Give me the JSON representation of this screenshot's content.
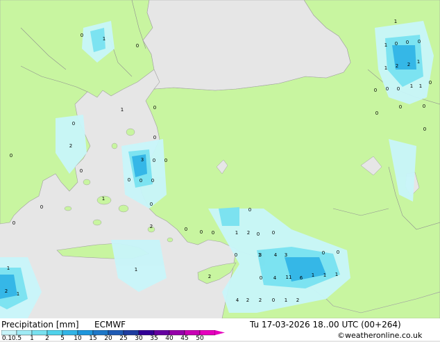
{
  "footer": {
    "title": "Precipitation [mm]",
    "model": "ECMWF",
    "datetime": "Tu 17-03-2026 18..00 UTC (00+264)",
    "credit": "©weatheronline.co.uk"
  },
  "legend": {
    "ticks": [
      "0.1",
      "0.5",
      "1",
      "2",
      "5",
      "10",
      "15",
      "20",
      "25",
      "30",
      "35",
      "40",
      "45",
      "50"
    ],
    "colors": [
      "#c8f5fa",
      "#a0ebf5",
      "#78e1f0",
      "#50d2eb",
      "#32b4e6",
      "#1e96dc",
      "#1e78c8",
      "#1e5ab4",
      "#1e3ca0",
      "#320096",
      "#6400a0",
      "#9600aa",
      "#c800b4",
      "#e600be"
    ]
  },
  "map": {
    "land_color": "#c8f5a0",
    "sea_color": "#e6e6e6",
    "labels": [
      "0",
      "1",
      "1",
      "1",
      "0",
      "0",
      "0",
      "0",
      "1",
      "2",
      "2",
      "1",
      "0",
      "0",
      "0",
      "1",
      "1",
      "0",
      "0",
      "0",
      "0",
      "0",
      "1",
      "0",
      "0",
      "2",
      "0",
      "3",
      "0",
      "0",
      "0",
      "0",
      "0",
      "1",
      "0",
      "0",
      "2",
      "0",
      "0",
      "0",
      "0",
      "0",
      "1",
      "2",
      "0",
      "0",
      "1",
      "0",
      "0",
      "3",
      "4",
      "3",
      "0",
      "0",
      "0",
      "4",
      "11",
      "6",
      "1",
      "1",
      "1",
      "2",
      "1",
      "1",
      "2",
      "1",
      "4",
      "2",
      "2",
      "0",
      "1",
      "2",
      "0"
    ]
  }
}
